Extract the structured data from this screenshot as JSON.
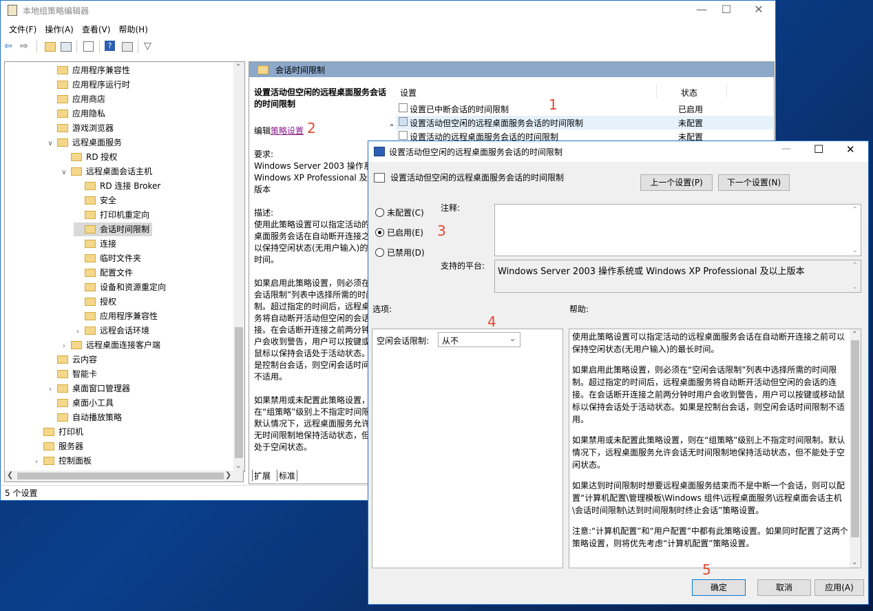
{
  "main_window": {
    "title": "本地组策略编辑器",
    "menu": [
      "文件(F)",
      "操作(A)",
      "查看(V)",
      "帮助(H)"
    ],
    "status": "5 个设置"
  },
  "tree": {
    "items": [
      {
        "label": "应用程序兼容性",
        "indent": 3,
        "expander": ""
      },
      {
        "label": "应用程序运行时",
        "indent": 3,
        "expander": ""
      },
      {
        "label": "应用商店",
        "indent": 3,
        "expander": ""
      },
      {
        "label": "应用隐私",
        "indent": 3,
        "expander": ""
      },
      {
        "label": "游戏浏览器",
        "indent": 3,
        "expander": ""
      },
      {
        "label": "远程桌面服务",
        "indent": 3,
        "expander": "v"
      },
      {
        "label": "RD 授权",
        "indent": 4,
        "expander": ""
      },
      {
        "label": "远程桌面会话主机",
        "indent": 4,
        "expander": "v"
      },
      {
        "label": "RD 连接 Broker",
        "indent": 5,
        "expander": ""
      },
      {
        "label": "安全",
        "indent": 5,
        "expander": ""
      },
      {
        "label": "打印机重定向",
        "indent": 5,
        "expander": ""
      },
      {
        "label": "会话时间限制",
        "indent": 5,
        "expander": "",
        "selected": true
      },
      {
        "label": "连接",
        "indent": 5,
        "expander": ""
      },
      {
        "label": "临时文件夹",
        "indent": 5,
        "expander": ""
      },
      {
        "label": "配置文件",
        "indent": 5,
        "expander": ""
      },
      {
        "label": "设备和资源重定向",
        "indent": 5,
        "expander": ""
      },
      {
        "label": "授权",
        "indent": 5,
        "expander": ""
      },
      {
        "label": "应用程序兼容性",
        "indent": 5,
        "expander": ""
      },
      {
        "label": "远程会话环境",
        "indent": 5,
        "expander": ">"
      },
      {
        "label": "远程桌面连接客户端",
        "indent": 4,
        "expander": ">"
      },
      {
        "label": "云内容",
        "indent": 3,
        "expander": ""
      },
      {
        "label": "智能卡",
        "indent": 3,
        "expander": ""
      },
      {
        "label": "桌面窗口管理器",
        "indent": 3,
        "expander": ">"
      },
      {
        "label": "桌面小工具",
        "indent": 3,
        "expander": ""
      },
      {
        "label": "自动播放策略",
        "indent": 3,
        "expander": ""
      },
      {
        "label": "打印机",
        "indent": 2,
        "expander": ""
      },
      {
        "label": "服务器",
        "indent": 2,
        "expander": ""
      },
      {
        "label": "控制面板",
        "indent": 2,
        "expander": ">"
      }
    ]
  },
  "right_pane": {
    "header": "会话时间限制",
    "desc_title": "设置活动但空闲的远程桌面服务会话的时间限制",
    "edit_prefix": "编辑",
    "edit_link": "策略设置",
    "req_label": "要求:",
    "req_text": "Windows Server 2003 操作系统或 Windows XP Professional 及以上版本",
    "desc_label": "描述:",
    "desc_p1": "使用此策略设置可以指定活动的远程桌面服务会话在自动断开连接之前可以保持空闲状态(无用户输入)的最长时间。",
    "desc_p2": "如果启用此策略设置，则必须在“空闲会话限制”列表中选择所需的时间限制。超过指定的时间后，远程桌面服务将自动断开活动但空闲的会话的连接。在会话断开连接之前两分钟时用户会收到警告，用户可以按键或移动鼠标以保持会话处于活动状态。如果是控制台会话，则空闲会话时间限制不适用。",
    "desc_p3": "如果禁用或未配置此策略设置，则在“组策略”级别上不指定时间限制。默认情况下，远程桌面服务允许会话无时间限制地保持活动状态，但不能处于空闲状态。",
    "col_setting": "设置",
    "col_state": "状态",
    "rows": [
      {
        "name": "设置已中断会话的时间限制",
        "state": "已启用"
      },
      {
        "name": "设置活动但空闲的远程桌面服务会话的时间限制",
        "state": "未配置"
      },
      {
        "name": "设置活动的远程桌面服务会话的时间限制",
        "state": "未配置"
      }
    ],
    "tabs": [
      "扩展",
      "标准"
    ]
  },
  "dialog": {
    "title": "设置活动但空闲的远程桌面服务会话的时间限制",
    "setting_name": "设置活动但空闲的远程桌面服务会话的时间限制",
    "prev_button": "上一个设置(P)",
    "next_button": "下一个设置(N)",
    "radio_not_configured": "未配置(C)",
    "radio_enabled": "已启用(E)",
    "radio_disabled": "已禁用(D)",
    "comment_label": "注释:",
    "platform_label": "支持的平台:",
    "platform_value": "Windows Server 2003 操作系统或 Windows XP Professional 及以上版本",
    "options_label": "选项:",
    "help_label": "帮助:",
    "idle_label": "空闲会话限制:",
    "idle_value": "从不",
    "help_p1": "使用此策略设置可以指定活动的远程桌面服务会话在自动断开连接之前可以保持空闲状态(无用户输入)的最长时间。",
    "help_p2": "如果启用此策略设置，则必须在“空闲会话限制”列表中选择所需的时间限制。超过指定的时间后，远程桌面服务将自动断开活动但空闲的会话的连接。在会话断开连接之前两分钟时用户会收到警告，用户可以按键或移动鼠标以保持会话处于活动状态。如果是控制台会话，则空闲会话时间限制不适用。",
    "help_p3": "如果禁用或未配置此策略设置，则在“组策略”级别上不指定时间限制。默认情况下，远程桌面服务允许会话无时间限制地保持活动状态，但不能处于空闲状态。",
    "help_p4": "如果达到时间限制时想要远程桌面服务结束而不是中断一个会话，则可以配置“计算机配置\\管理模板\\Windows 组件\\远程桌面服务\\远程桌面会话主机\\会话时间限制\\达到时间限制时终止会话”策略设置。",
    "help_p5": "注意:“计算机配置”和“用户配置”中都有此策略设置。如果同时配置了这两个策略设置，则将优先考虑“计算机配置”策略设置。",
    "ok": "确定",
    "cancel": "取消",
    "apply": "应用(A)"
  },
  "annotations": [
    "1",
    "2",
    "3",
    "4",
    "5"
  ],
  "colors": {
    "accent": "#1e6ec8",
    "annotation": "#e2472f",
    "pane_header": "#8da9c9",
    "link": "#8b1a8b"
  }
}
